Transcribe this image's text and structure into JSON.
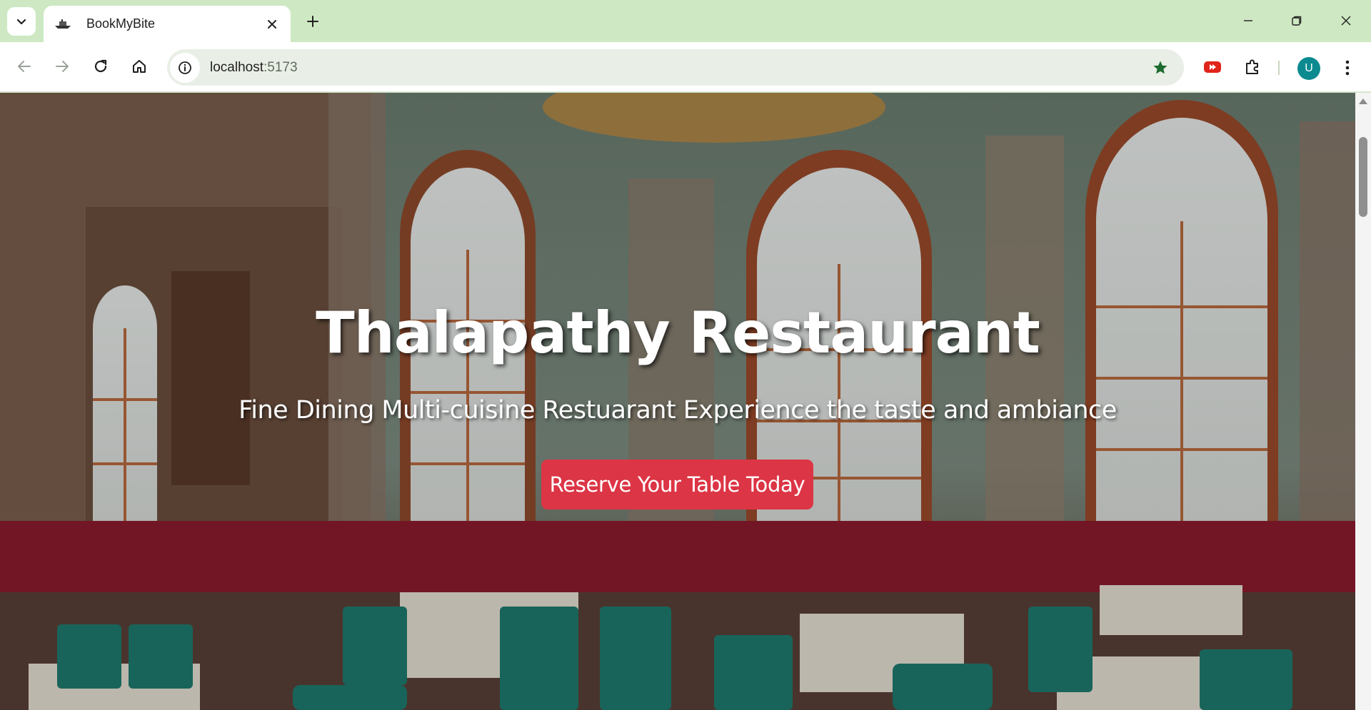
{
  "browser": {
    "tab": {
      "title": "BookMyBite",
      "favicon": "boat-favicon-icon",
      "close_icon": "close-icon"
    },
    "new_tab_icon": "plus-icon",
    "tab_search_icon": "chevron-down-icon",
    "window_controls": [
      "minimize-icon",
      "restore-icon",
      "close-icon"
    ],
    "nav": [
      "back-arrow-icon",
      "forward-arrow-icon",
      "reload-icon",
      "home-icon"
    ],
    "omnibox": {
      "host": "localhost",
      "port": ":5173",
      "site_info_icon": "info-icon",
      "bookmark_icon": "star-icon"
    },
    "extensions": [
      "youtube-extension-icon",
      "puzzle-icon"
    ],
    "profile_initial": "U",
    "menu_icon": "kebab-menu-icon",
    "colors": {
      "frame": "#cde8c2",
      "omnibox": "#e9efe6",
      "star": "#1e6b2f",
      "avatar": "#0b8a8f"
    }
  },
  "page": {
    "hero": {
      "title": "Thalapathy Restaurant",
      "subtitle": "Fine Dining Multi-cuisine Restuarant Experience the taste and ambiance",
      "cta_label": "Reserve Your Table Today",
      "background": "restaurant-interior-photo",
      "colors": {
        "cta": "#dc3545",
        "text": "#ffffff"
      }
    }
  }
}
